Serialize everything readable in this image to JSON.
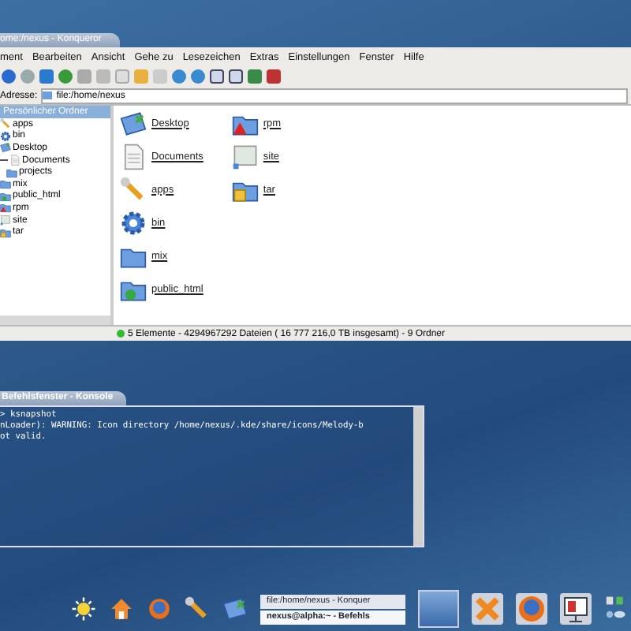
{
  "browser": {
    "title": "ome:/nexus - Konqueror",
    "menu": [
      "ment",
      "Bearbeiten",
      "Ansicht",
      "Gehe zu",
      "Lesezeichen",
      "Extras",
      "Einstellungen",
      "Fenster",
      "Hilfe"
    ],
    "address_label": "Adresse:",
    "address": "file:/home/nexus",
    "sidebar": {
      "header": "Persönlicher Ordner",
      "items": [
        {
          "label": "apps",
          "kind": "wrench"
        },
        {
          "label": "bin",
          "kind": "gear"
        },
        {
          "label": "Desktop",
          "kind": "desktop"
        },
        {
          "label": "Documents",
          "kind": "doc",
          "expanded": true,
          "children": [
            {
              "label": "projects",
              "kind": "folder"
            }
          ]
        },
        {
          "label": "mix",
          "kind": "folder"
        },
        {
          "label": "public_html",
          "kind": "globe"
        },
        {
          "label": "rpm",
          "kind": "warn"
        },
        {
          "label": "site",
          "kind": "site"
        },
        {
          "label": "tar",
          "kind": "box"
        }
      ]
    },
    "files": [
      {
        "label": "Desktop",
        "kind": "desktop"
      },
      {
        "label": "Documents",
        "kind": "doc"
      },
      {
        "label": "apps",
        "kind": "wrench"
      },
      {
        "label": "bin",
        "kind": "gear"
      },
      {
        "label": "mix",
        "kind": "folder"
      },
      {
        "label": "public_html",
        "kind": "globe"
      },
      {
        "label": "rpm",
        "kind": "warn"
      },
      {
        "label": "site",
        "kind": "site"
      },
      {
        "label": "tar",
        "kind": "box"
      }
    ],
    "status": "5 Elemente - 4294967292 Dateien ( 16 777 216,0 TB insgesamt) - 9 Ordner"
  },
  "console": {
    "title": "Befehlsfenster - Konsole",
    "lines": [
      "> ksnapshot",
      "nLoader): WARNING: Icon directory /home/nexus/.kde/share/icons/Melody-b",
      "ot valid."
    ]
  },
  "taskbar": {
    "tasks": [
      {
        "label": "file:/home/nexus - Konquer",
        "selected": false
      },
      {
        "label": "nexus@alpha:~ - Befehls",
        "selected": true
      }
    ]
  }
}
